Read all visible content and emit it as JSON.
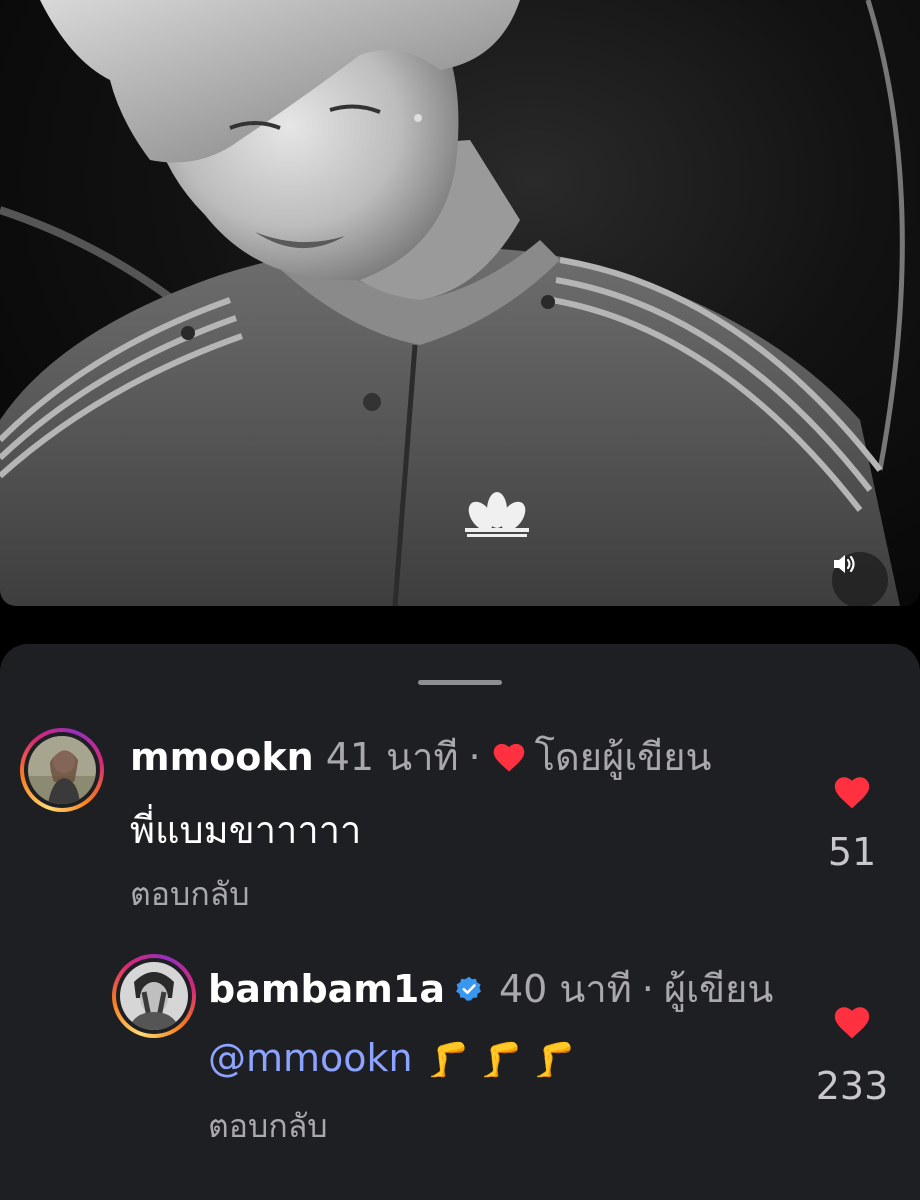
{
  "video": {
    "sound_icon": "speaker-icon",
    "logo_icon": "trefoil-logo-icon"
  },
  "comments": {
    "top": {
      "username": "mmookn",
      "time": "41 นาที",
      "separator": "·",
      "liked_by": "โดยผู้เขียน",
      "text": "พี่แบมขาาาาา",
      "reply_label": "ตอบกลับ",
      "like_count": "51"
    },
    "reply": {
      "username": "bambam1a",
      "time": "40 นาที",
      "separator": "·",
      "author_label": "ผู้เขียน",
      "mention": "@mmookn",
      "emoji": "🦵 🦵 🦵",
      "reply_label": "ตอบกลับ",
      "like_count": "233"
    }
  },
  "colors": {
    "like_red": "#ff3040",
    "mention_blue": "#8ca3ff",
    "verified_blue": "#3897f0",
    "sheet_bg": "#1e1f22"
  }
}
